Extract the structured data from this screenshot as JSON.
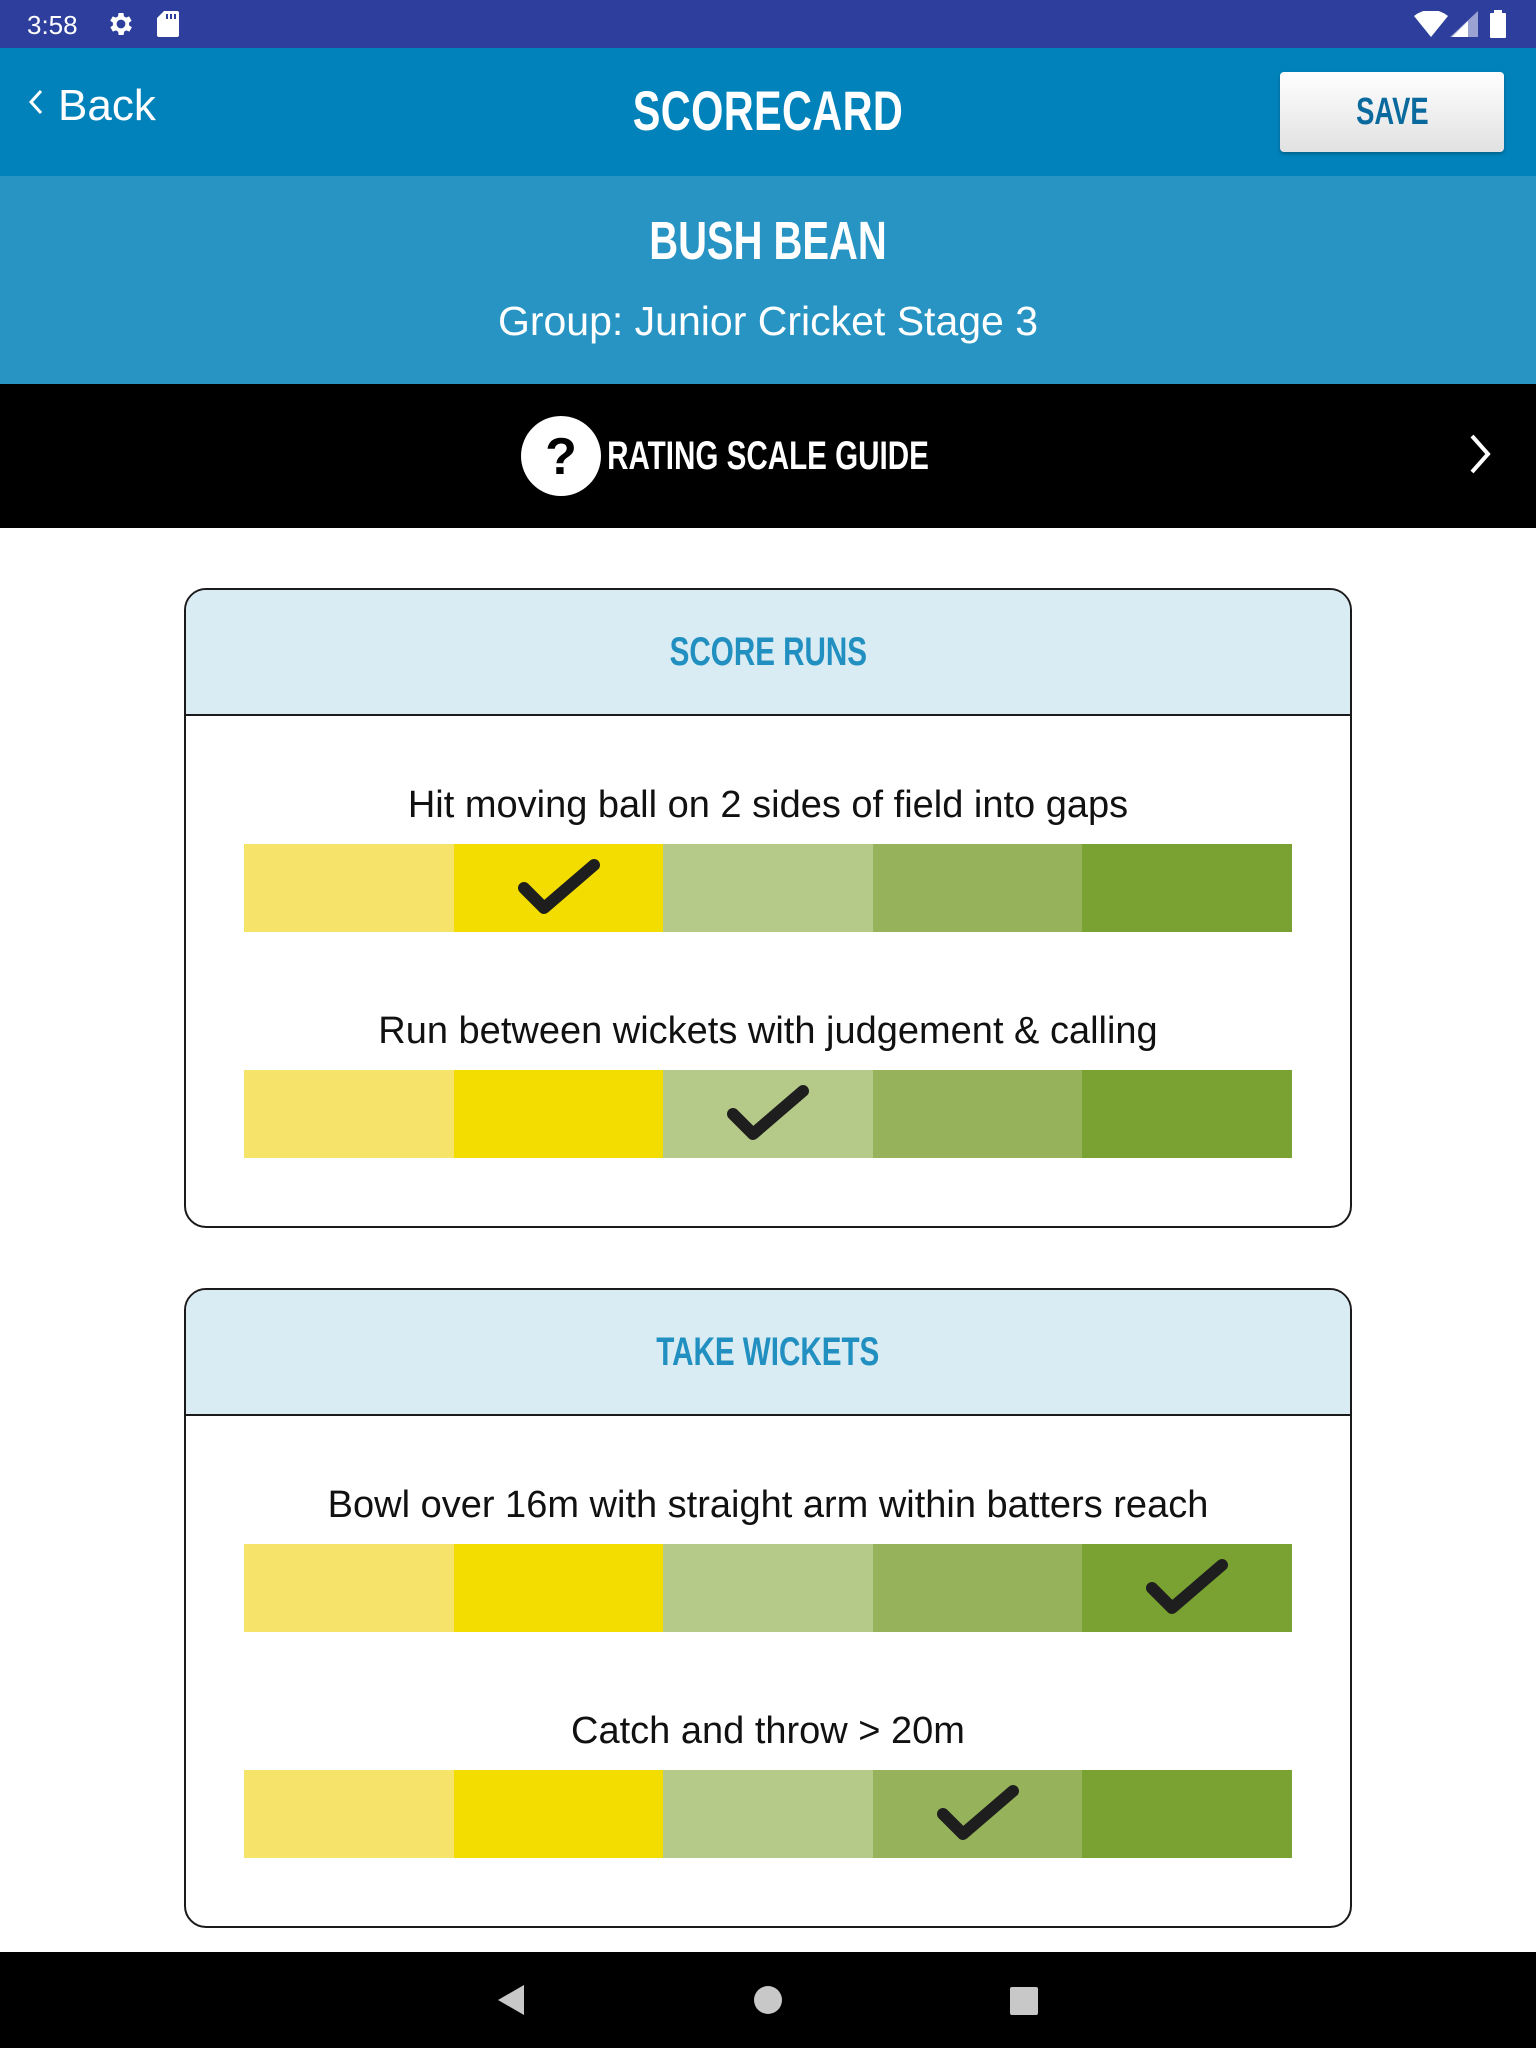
{
  "status_bar": {
    "time": "3:58",
    "icons": [
      "gear-icon",
      "sd-card-icon",
      "wifi-icon",
      "signal-icon",
      "battery-icon"
    ]
  },
  "header": {
    "back_label": "Back",
    "title": "SCORECARD",
    "save_label": "SAVE"
  },
  "player": {
    "name": "BUSH BEAN",
    "group": "Group: Junior Cricket Stage 3"
  },
  "rating_guide": {
    "label": "RATING SCALE GUIDE",
    "icon": "question-icon"
  },
  "scale_colors": [
    "#f6e46a",
    "#f3dd00",
    "#b5ca89",
    "#96b35b",
    "#79a232"
  ],
  "sections": [
    {
      "title": "SCORE RUNS",
      "skills": [
        {
          "label": "Hit moving ball on 2 sides of field into gaps",
          "rating": 2
        },
        {
          "label": "Run between wickets with judgement & calling",
          "rating": 3
        }
      ]
    },
    {
      "title": "TAKE WICKETS",
      "skills": [
        {
          "label": "Bowl over 16m with straight arm within batters reach",
          "rating": 5
        },
        {
          "label": "Catch and throw > 20m",
          "rating": 4
        }
      ]
    }
  ],
  "nav_bar": {
    "icons": [
      "nav-back-icon",
      "nav-home-icon",
      "nav-recents-icon"
    ]
  }
}
